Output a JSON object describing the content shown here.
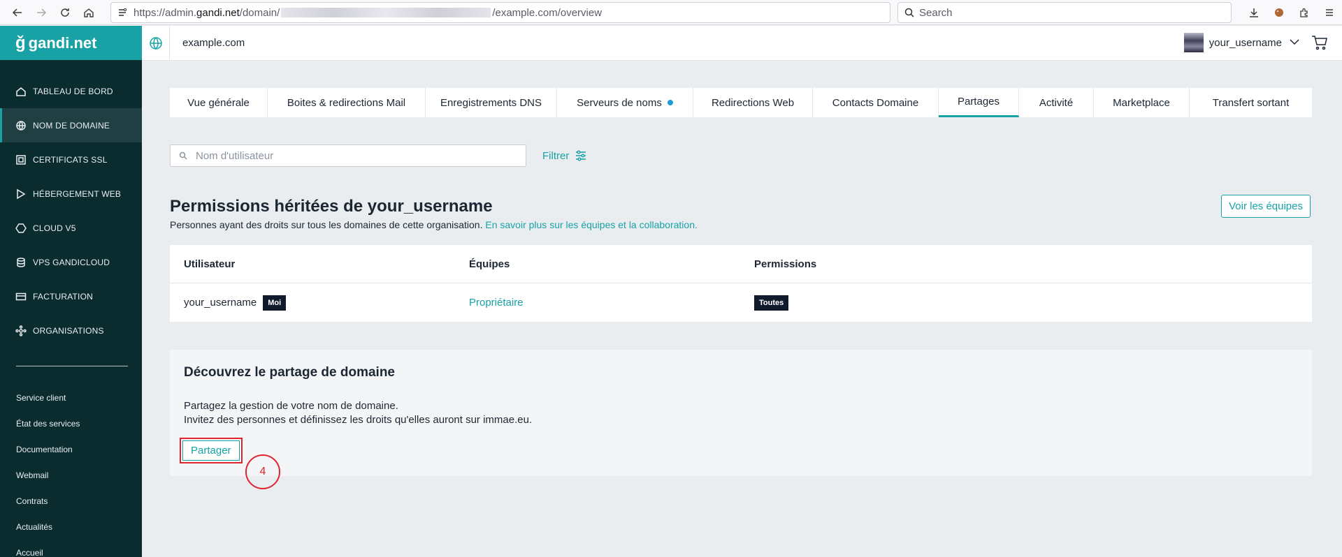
{
  "browser": {
    "url_prefix": "https://admin.",
    "url_host": "gandi.net",
    "url_path1": "/domain/",
    "url_suffix": "/example.com/overview",
    "search_placeholder": "Search"
  },
  "sidebar": {
    "logo": "gandi.net",
    "items": [
      {
        "label": "TABLEAU DE BORD",
        "icon": "home-icon"
      },
      {
        "label": "NOM DE DOMAINE",
        "icon": "globe-icon"
      },
      {
        "label": "CERTIFICATS SSL",
        "icon": "certificate-icon"
      },
      {
        "label": "HÉBERGEMENT WEB",
        "icon": "hosting-icon"
      },
      {
        "label": "CLOUD V5",
        "icon": "cloud-icon"
      },
      {
        "label": "VPS GANDICLOUD",
        "icon": "server-icon"
      },
      {
        "label": "FACTURATION",
        "icon": "billing-icon"
      },
      {
        "label": "ORGANISATIONS",
        "icon": "organizations-icon"
      }
    ],
    "links": [
      "Service client",
      "État des services",
      "Documentation",
      "Webmail",
      "Contrats",
      "Actualités",
      "Accueil"
    ]
  },
  "header": {
    "domain": "example.com",
    "username": "your_username"
  },
  "tabs": [
    {
      "label": "Vue générale"
    },
    {
      "label": "Boites & redirections Mail"
    },
    {
      "label": "Enregistrements DNS"
    },
    {
      "label": "Serveurs de noms"
    },
    {
      "label": "Redirections Web"
    },
    {
      "label": "Contacts Domaine"
    },
    {
      "label": "Partages"
    },
    {
      "label": "Activité"
    },
    {
      "label": "Marketplace"
    },
    {
      "label": "Transfert sortant"
    }
  ],
  "filter": {
    "placeholder": "Nom d'utilisateur",
    "button_label": "Filtrer"
  },
  "permissions": {
    "title": "Permissions héritées de your_username",
    "description": "Personnes ayant des droits sur tous les domaines de cette organisation.",
    "link": "En savoir plus sur les équipes et la collaboration.",
    "teams_button": "Voir les équipes",
    "columns": [
      "Utilisateur",
      "Équipes",
      "Permissions"
    ],
    "rows": [
      {
        "user": "your_username",
        "badge": "Moi",
        "team": "Propriétaire",
        "permission": "Toutes"
      }
    ]
  },
  "share": {
    "title": "Découvrez le partage de domaine",
    "line1": "Partagez la gestion de votre nom de domaine.",
    "line2": "Invitez des personnes et définissez les droits qu'elles auront sur immae.eu.",
    "button": "Partager",
    "step": "4"
  },
  "colors": {
    "accent": "#18a2a6",
    "sidebar": "#0b2c2f",
    "annotation": "#e0242f"
  }
}
